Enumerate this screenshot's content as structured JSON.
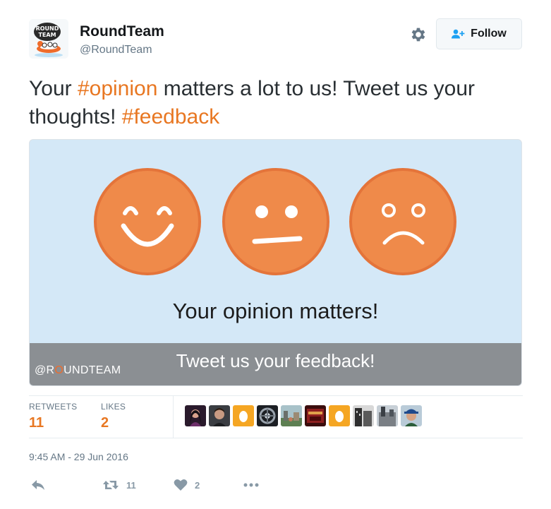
{
  "account": {
    "name": "RoundTeam",
    "handle": "@RoundTeam",
    "avatar_text": "ROUND TEAM"
  },
  "header": {
    "follow_label": "Follow",
    "settings_icon": "gear-icon",
    "follow_icon": "add-person-icon"
  },
  "tweet": {
    "text_parts": [
      {
        "text": "Your ",
        "type": "text"
      },
      {
        "text": "#opinion",
        "type": "hashtag"
      },
      {
        "text": " matters a lot to us! Tweet us your thoughts! ",
        "type": "text"
      },
      {
        "text": "#feedback",
        "type": "hashtag"
      }
    ]
  },
  "media": {
    "title": "Your opinion matters!",
    "subtitle": "Tweet us your feedback!",
    "brand_prefix": "@R",
    "brand_o": "O",
    "brand_suffix": "UNDTEAM",
    "faces": [
      "happy-face-icon",
      "neutral-face-icon",
      "sad-face-icon"
    ]
  },
  "stats": {
    "retweets_label": "RETWEETS",
    "retweets_value": "11",
    "likes_label": "LIKES",
    "likes_value": "2",
    "liker_count": 10
  },
  "timestamp": "9:45 AM - 29 Jun 2016",
  "actions": {
    "reply_icon": "reply-icon",
    "retweet_icon": "retweet-icon",
    "retweet_count": "11",
    "like_icon": "heart-icon",
    "like_count": "2",
    "more_icon": "more-icon"
  },
  "colors": {
    "accent": "#e87722",
    "face_fill": "#ef8a4a",
    "media_bg": "#d4e8f7",
    "media_bar": "#8b8f93"
  }
}
